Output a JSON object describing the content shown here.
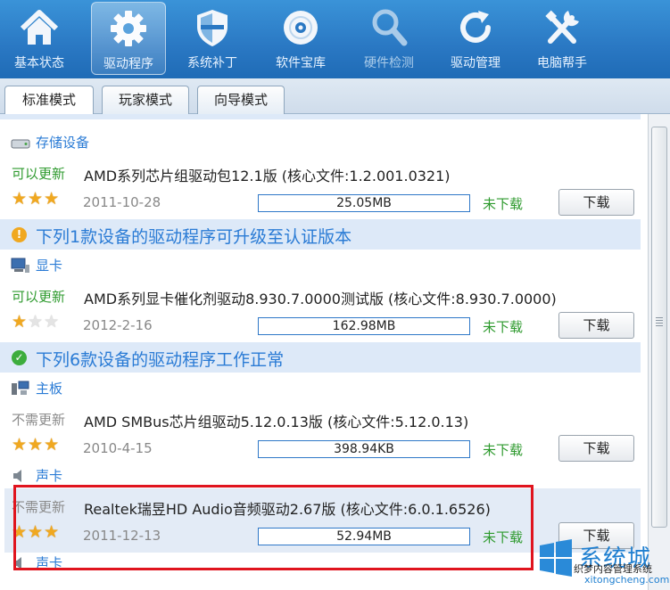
{
  "toolbar": [
    {
      "label": "基本状态",
      "icon": "home-icon",
      "state": "normal"
    },
    {
      "label": "驱动程序",
      "icon": "gear-icon",
      "state": "active"
    },
    {
      "label": "系统补丁",
      "icon": "shield-icon",
      "state": "normal"
    },
    {
      "label": "软件宝库",
      "icon": "disc-icon",
      "state": "normal"
    },
    {
      "label": "硬件检测",
      "icon": "magnifier-icon",
      "state": "disabled"
    },
    {
      "label": "驱动管理",
      "icon": "refresh-icon",
      "state": "normal"
    },
    {
      "label": "电脑帮手",
      "icon": "tools-icon",
      "state": "normal"
    }
  ],
  "tabs": [
    {
      "label": "标准模式",
      "active": true
    },
    {
      "label": "玩家模式",
      "active": false
    },
    {
      "label": "向导模式",
      "active": false
    }
  ],
  "sections": {
    "cert": {
      "title": "下列1款设备的驱动程序可升级至认证版本",
      "color": "#f0a820"
    },
    "normal": {
      "title": "下列6款设备的驱动程序工作正常",
      "color": "#3dad3d"
    }
  },
  "categories": {
    "storage": "存储设备",
    "gpu": "显卡",
    "board": "主板",
    "sound": "声卡",
    "sound2": "声卡"
  },
  "rows": [
    {
      "status": "可以更新",
      "name": "AMD系列芯片组驱动包12.1版 (核心文件:1.2.001.0321)",
      "rating": 3,
      "date": "2011-10-28",
      "size": "25.05MB",
      "dl_status": "未下载",
      "button": "下载"
    },
    {
      "status": "可以更新",
      "name": "AMD系列显卡催化剂驱动8.930.7.0000测试版 (核心文件:8.930.7.0000)",
      "rating": 1,
      "date": "2012-2-16",
      "size": "162.98MB",
      "dl_status": "未下载",
      "button": "下载"
    },
    {
      "status": "不需更新",
      "name": "AMD SMBus芯片组驱动5.12.0.13版 (核心文件:5.12.0.13)",
      "rating": 3,
      "date": "2010-4-15",
      "size": "398.94KB",
      "dl_status": "未下载",
      "button": "下载"
    },
    {
      "status": "不需更新",
      "name": "Realtek瑞昱HD Audio音频驱动2.67版 (核心文件:6.0.1.6526)",
      "rating": 3,
      "date": "2011-12-13",
      "size": "52.94MB",
      "dl_status": "未下载",
      "button": "下载"
    }
  ],
  "watermark": {
    "big": "系统城",
    "line1": "织梦内容管理系统",
    "line2": "xitongcheng.com"
  },
  "colors": {
    "accent": "#2a7bd5",
    "toolbar": "#2a78c3",
    "update": "#2e9a2e",
    "highlight": "#e0141e"
  }
}
